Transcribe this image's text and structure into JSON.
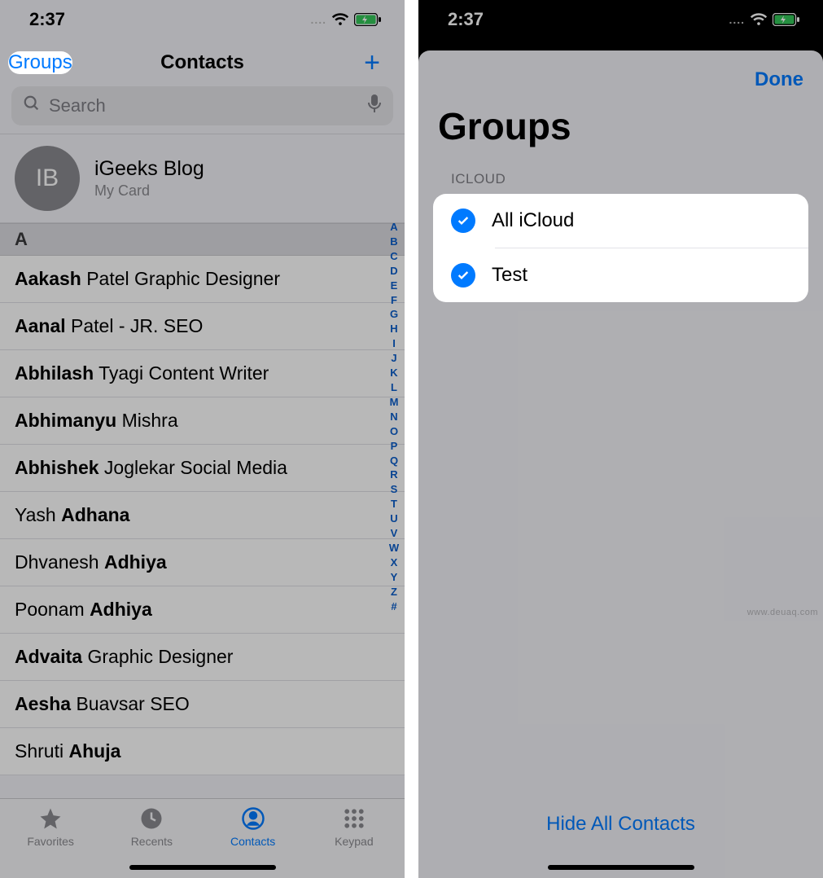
{
  "status": {
    "time": "2:37",
    "cell_dots": "....",
    "wifi": "wifi",
    "battery": "charging"
  },
  "left": {
    "nav": {
      "groups": "Groups",
      "title": "Contacts",
      "add": "+"
    },
    "search": {
      "placeholder": "Search"
    },
    "me": {
      "initials": "IB",
      "name": "iGeeks Blog",
      "sub": "My Card"
    },
    "section": "A",
    "contacts": [
      {
        "first": "Aakash",
        "rest": "Patel Graphic Designer"
      },
      {
        "first": "Aanal",
        "rest": "Patel - JR. SEO"
      },
      {
        "first": "Abhilash",
        "rest": "Tyagi Content Writer"
      },
      {
        "first": "Abhimanyu",
        "rest": "Mishra"
      },
      {
        "first": "Abhishek",
        "rest": "Joglekar Social Media"
      },
      {
        "prefix": "Yash ",
        "bold": "Adhana"
      },
      {
        "prefix": "Dhvanesh ",
        "bold": "Adhiya"
      },
      {
        "prefix": "Poonam ",
        "bold": "Adhiya"
      },
      {
        "first": "Advaita",
        "rest": "Graphic Designer"
      },
      {
        "first": "Aesha",
        "rest": "Buavsar SEO"
      },
      {
        "prefix": "Shruti ",
        "bold": "Ahuja"
      }
    ],
    "index": [
      "A",
      "B",
      "C",
      "D",
      "E",
      "F",
      "G",
      "H",
      "I",
      "J",
      "K",
      "L",
      "M",
      "N",
      "O",
      "P",
      "Q",
      "R",
      "S",
      "T",
      "U",
      "V",
      "W",
      "X",
      "Y",
      "Z",
      "#"
    ],
    "tabs": {
      "favorites": "Favorites",
      "recents": "Recents",
      "contacts": "Contacts",
      "keypad": "Keypad"
    }
  },
  "right": {
    "done": "Done",
    "title": "Groups",
    "section_label": "ICLOUD",
    "groups": [
      {
        "name": "All iCloud",
        "checked": true
      },
      {
        "name": "Test",
        "checked": true
      }
    ],
    "hide_all": "Hide All Contacts"
  },
  "watermark": "www.deuaq.com"
}
